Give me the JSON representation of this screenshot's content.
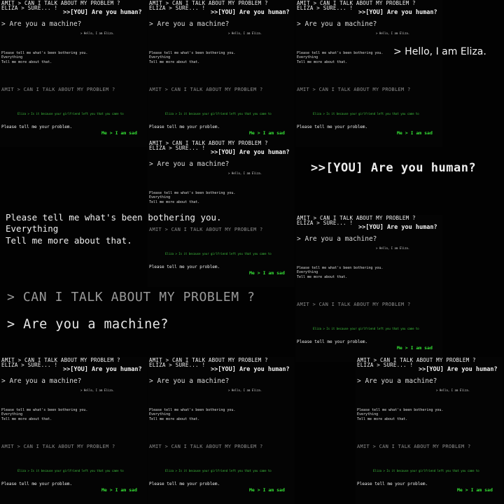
{
  "convo": {
    "header1": "AMIT > CAN I TALK ABOUT MY PROBLEM ?",
    "header2": "ELIZA > SURE... !",
    "you_human": ">>[YOU] Are you human?",
    "machine": "> Are you a machine?",
    "hello": "> Hello, I am Eliza.",
    "bothering": "Please tell me what's been bothering you.\nEverything\nTell me more about that.",
    "talk": "AMIT > CAN I TALK ABOUT MY PROBLEM ?",
    "girlfriend": "Eliza > Is it because your girlfriend left you that you came to",
    "problem": "Please tell me your problem.",
    "sad": "Me > I am sad"
  },
  "zoomed": {
    "hello": "> Hello, I am Eliza.",
    "you_human": ">>[YOU] Are you human?",
    "bothering": "Please tell me what's been bothering you.\nEverything\nTell me more about that.",
    "talk": "> CAN I TALK ABOUT MY PROBLEM ?",
    "machine": "> Are you a machine?"
  }
}
